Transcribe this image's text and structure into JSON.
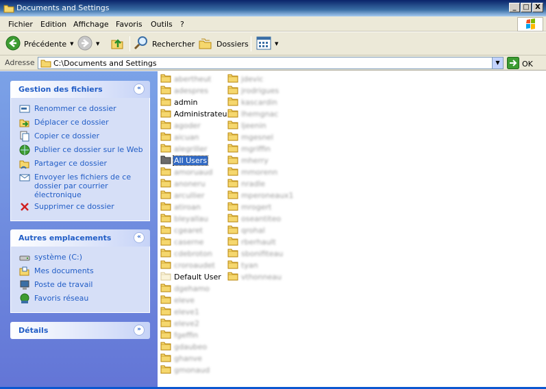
{
  "window": {
    "title": "Documents and Settings",
    "buttons": {
      "minimize": "_",
      "maximize": "□",
      "close": "X"
    }
  },
  "menu": {
    "items": [
      "Fichier",
      "Edition",
      "Affichage",
      "Favoris",
      "Outils",
      "?"
    ]
  },
  "toolbar": {
    "back_label": "Précédente",
    "search_label": "Rechercher",
    "folders_label": "Dossiers",
    "views_icon": "views-icon"
  },
  "address": {
    "label": "Adresse",
    "value": "C:\\Documents and Settings",
    "go_label": "OK"
  },
  "panels": {
    "file_tasks": {
      "title": "Gestion des fichiers",
      "toggle": "«",
      "items": [
        {
          "label": "Renommer ce dossier",
          "icon": "rename-icon"
        },
        {
          "label": "Déplacer ce dossier",
          "icon": "move-icon"
        },
        {
          "label": "Copier ce dossier",
          "icon": "copy-icon"
        },
        {
          "label": "Publier ce dossier sur le Web",
          "icon": "web-publish-icon"
        },
        {
          "label": "Partager ce dossier",
          "icon": "share-icon"
        },
        {
          "label": "Envoyer les fichiers de ce dossier par courrier électronique",
          "icon": "email-icon"
        },
        {
          "label": "Supprimer ce dossier",
          "icon": "delete-icon"
        }
      ]
    },
    "other_places": {
      "title": "Autres emplacements",
      "toggle": "«",
      "items": [
        {
          "label": "système (C:)",
          "icon": "drive-icon"
        },
        {
          "label": "Mes documents",
          "icon": "my-documents-icon"
        },
        {
          "label": "Poste de travail",
          "icon": "my-computer-icon"
        },
        {
          "label": "Favoris réseau",
          "icon": "network-icon"
        }
      ]
    },
    "details": {
      "title": "Détails",
      "toggle": "»"
    }
  },
  "files": {
    "column1": [
      {
        "name": "abertheut",
        "blurred": true
      },
      {
        "name": "adespres",
        "blurred": true
      },
      {
        "name": "admin",
        "blurred": false
      },
      {
        "name": "Administrateur",
        "blurred": false
      },
      {
        "name": "agoder",
        "blurred": true
      },
      {
        "name": "aicuan",
        "blurred": true
      },
      {
        "name": "alegriller",
        "blurred": true
      },
      {
        "name": "All Users",
        "blurred": false,
        "selected": true
      },
      {
        "name": "amoruaud",
        "blurred": true
      },
      {
        "name": "anoneru",
        "blurred": true
      },
      {
        "name": "arcullier",
        "blurred": true
      },
      {
        "name": "atiroan",
        "blurred": true
      },
      {
        "name": "bleyallau",
        "blurred": true
      },
      {
        "name": "cgearet",
        "blurred": true
      },
      {
        "name": "caserne",
        "blurred": true
      },
      {
        "name": "cdebroton",
        "blurred": true
      },
      {
        "name": "croroaudet",
        "blurred": true
      },
      {
        "name": "Default User",
        "blurred": false,
        "ghost": true
      },
      {
        "name": "dgehamo",
        "blurred": true
      },
      {
        "name": "eleve",
        "blurred": true
      },
      {
        "name": "eleve1",
        "blurred": true
      },
      {
        "name": "eleve2",
        "blurred": true
      },
      {
        "name": "fgeffin",
        "blurred": true
      },
      {
        "name": "gdaubeo",
        "blurred": true
      },
      {
        "name": "ghanve",
        "blurred": true
      },
      {
        "name": "gmonaud",
        "blurred": true
      }
    ],
    "column2": [
      {
        "name": "jdevic",
        "blurred": true
      },
      {
        "name": "jrodrigues",
        "blurred": true
      },
      {
        "name": "kascardin",
        "blurred": true
      },
      {
        "name": "lhemgnac",
        "blurred": true
      },
      {
        "name": "ljeenin",
        "blurred": true
      },
      {
        "name": "mgesnel",
        "blurred": true
      },
      {
        "name": "mgriffin",
        "blurred": true
      },
      {
        "name": "mherry",
        "blurred": true
      },
      {
        "name": "mmorenn",
        "blurred": true
      },
      {
        "name": "nradle",
        "blurred": true
      },
      {
        "name": "mperoneaux1",
        "blurred": true
      },
      {
        "name": "mrogert",
        "blurred": true
      },
      {
        "name": "oseantiteo",
        "blurred": true
      },
      {
        "name": "qrohal",
        "blurred": true
      },
      {
        "name": "rberhault",
        "blurred": true
      },
      {
        "name": "sbonifiteau",
        "blurred": true
      },
      {
        "name": "tyan",
        "blurred": true
      },
      {
        "name": "vthonneau",
        "blurred": true
      }
    ]
  }
}
